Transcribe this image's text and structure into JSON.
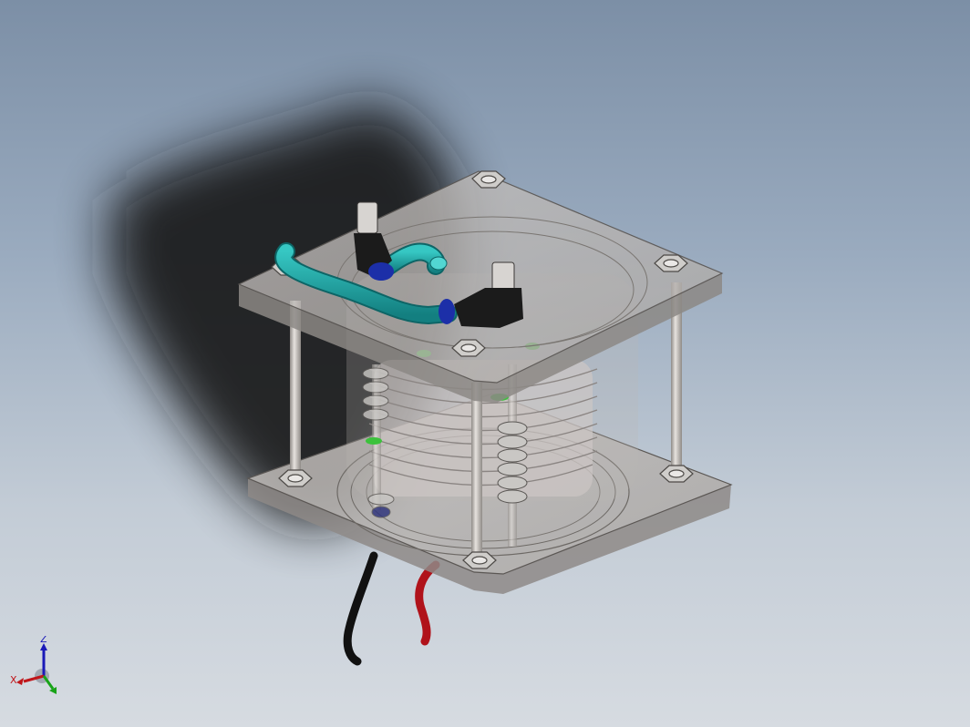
{
  "viewport": {
    "background_top": "#7c8fa6",
    "background_bottom": "#d6dbe1"
  },
  "model": {
    "plate_color": "#b9b6b4",
    "rod_color": "#d7d3cf",
    "nut_color": "#c9c7c4",
    "tube_color": "#1fa5a5",
    "fitting_color": "#1b1b1b",
    "collar_color": "#1c2fa8",
    "wire_black": "#111111",
    "wire_red": "#b0121a",
    "seal_color": "#3cc23c"
  },
  "triad": {
    "x_label": "X",
    "y_label": "Y",
    "z_label": "Z",
    "x_color": "#c0161a",
    "y_color": "#18a318",
    "z_color": "#1a1ab8"
  }
}
